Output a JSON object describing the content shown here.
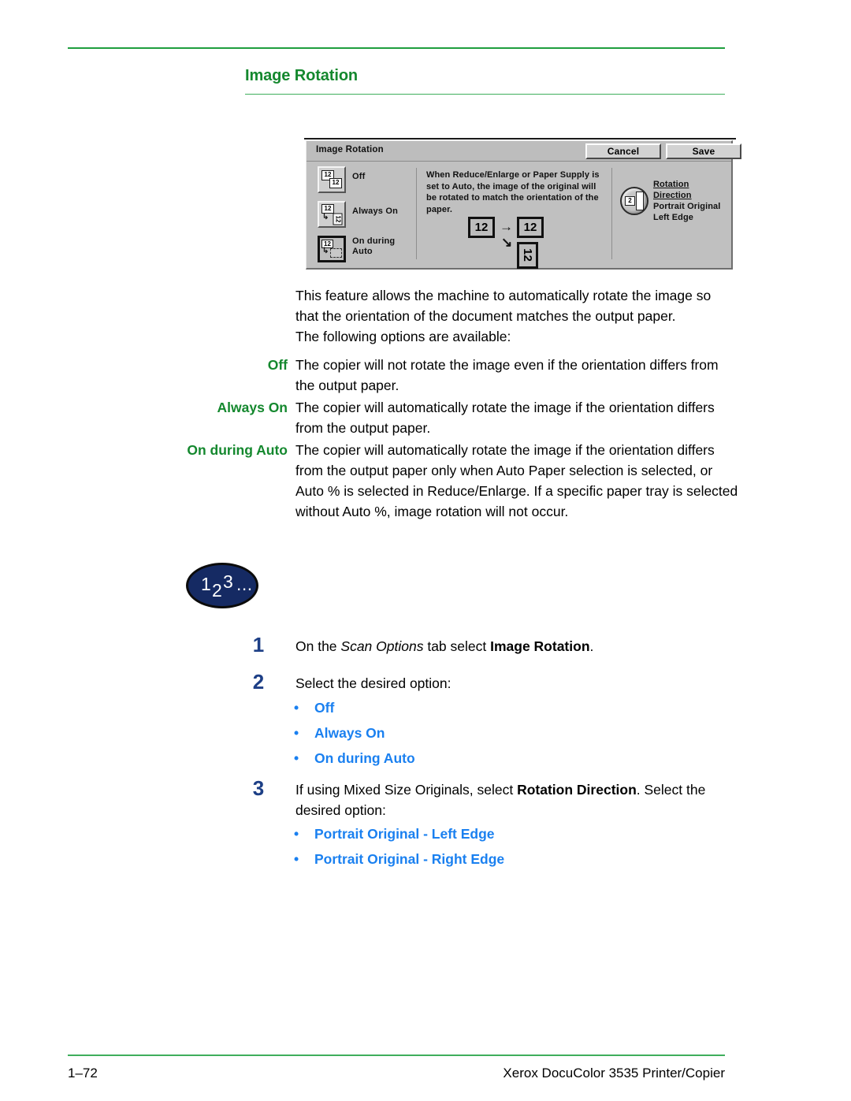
{
  "page": {
    "title": "Image Rotation",
    "accent_green": "#14882e",
    "accent_blue": "#1a80f0",
    "step_number_blue": "#1d3f86"
  },
  "ui_panel": {
    "titlebar_label": "Image Rotation",
    "cancel_label": "Cancel",
    "save_label": "Save",
    "options": [
      {
        "label": "Off",
        "selected": false
      },
      {
        "label": "Always On",
        "selected": false
      },
      {
        "label": "On during",
        "label2": "Auto",
        "selected": true
      }
    ],
    "description": "When Reduce/Enlarge or Paper Supply is set to Auto, the image of the original will be rotated to match the orientation of the paper.",
    "diagram": {
      "source": "12",
      "result_horizontal": "12",
      "result_rotated": "12",
      "arrow_right": "→",
      "arrow_down": "↘"
    },
    "rotation_direction": {
      "heading_line1": "Rotation",
      "heading_line2": "Direction",
      "value_line1": "Portrait Original",
      "value_line2": "Left Edge",
      "knob_glyph": "2"
    }
  },
  "body": {
    "intro_1": "This feature allows the machine to automatically rotate the image so that the orientation of the document matches the output paper.",
    "intro_2": "The following options are available:",
    "definitions": [
      {
        "term": "Off",
        "description": "The copier will not rotate the image even if the orientation differs from the output paper."
      },
      {
        "term": "Always On",
        "description": "The copier will automatically rotate the image if the orientation differs from the output paper."
      },
      {
        "term": "On during Auto",
        "description": "The copier will automatically rotate the image if the orientation differs from the output paper only when Auto Paper selection is selected, or Auto % is selected in Reduce/Enlarge.  If a specific paper tray is selected without Auto %, image rotation will not occur."
      }
    ]
  },
  "procedure_badge": {
    "n1": "1",
    "n2": "2",
    "n3": "3",
    "dots": "..."
  },
  "steps": [
    {
      "number": "1",
      "text_part1": "On the ",
      "text_italic": "Scan Options",
      "text_part2": " tab select ",
      "text_bold": "Image Rotation",
      "text_part3": "."
    },
    {
      "number": "2",
      "text_part1": "Select the desired option:"
    },
    {
      "number": "3",
      "text_part1": "If using Mixed Size Originals, select ",
      "text_bold": "Rotation Direction",
      "text_part2": ". Select the desired option:"
    }
  ],
  "step2_bullets": [
    "Off",
    "Always On",
    "On during Auto"
  ],
  "step3_bullets": [
    "Portrait Original - Left Edge",
    "Portrait Original - Right Edge"
  ],
  "bullet_char": "•",
  "footer": {
    "page_number": "1–72",
    "product": "Xerox DocuColor 3535 Printer/Copier"
  }
}
